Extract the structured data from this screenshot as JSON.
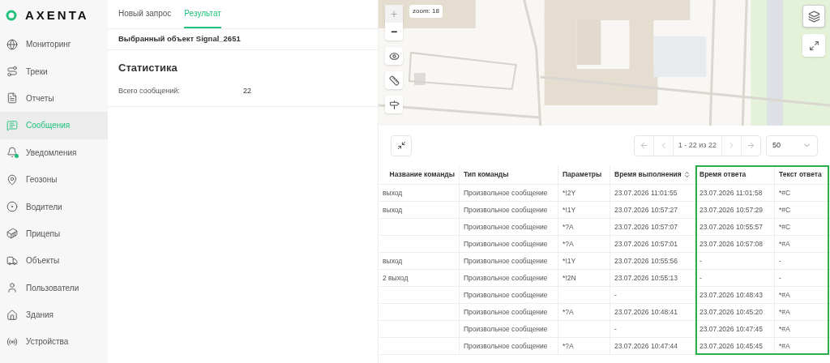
{
  "logo": {
    "text": "AXENTA"
  },
  "sidebar": {
    "items": [
      {
        "label": "Мониторинг",
        "selected": false,
        "dot": false
      },
      {
        "label": "Треки",
        "selected": false,
        "dot": false
      },
      {
        "label": "Отчеты",
        "selected": false,
        "dot": false
      },
      {
        "label": "Сообщения",
        "selected": true,
        "dot": false
      },
      {
        "label": "Уведомления",
        "selected": false,
        "dot": true
      },
      {
        "label": "Геозоны",
        "selected": false,
        "dot": false
      },
      {
        "label": "Водители",
        "selected": false,
        "dot": false
      },
      {
        "label": "Прицепы",
        "selected": false,
        "dot": false
      },
      {
        "label": "Объекты",
        "selected": false,
        "dot": false
      },
      {
        "label": "Пользователи",
        "selected": false,
        "dot": false
      },
      {
        "label": "Здания",
        "selected": false,
        "dot": false
      },
      {
        "label": "Устройства",
        "selected": false,
        "dot": false
      }
    ]
  },
  "tabs": [
    {
      "label": "Новый запрос",
      "selected": false
    },
    {
      "label": "Результат",
      "selected": true
    }
  ],
  "selected_object": "Выбранный объект Signal_2651",
  "statistics": {
    "title": "Статистика",
    "rows": [
      {
        "label": "Всего сообщений:",
        "value": "22"
      }
    ]
  },
  "map": {
    "zoom_label": "zoom: 18",
    "zoom_in": "+",
    "zoom_out": "−"
  },
  "pagination": {
    "range": "1 - 22 из 22",
    "page_size": "50"
  },
  "table": {
    "columns": [
      {
        "label": "Название команды",
        "sortable": false
      },
      {
        "label": "Тип команды",
        "sortable": false
      },
      {
        "label": "Параметры",
        "sortable": false
      },
      {
        "label": "Время выполнения",
        "sortable": true
      },
      {
        "label": "Время ответа",
        "sortable": false
      },
      {
        "label": "Текст ответа",
        "sortable": false
      }
    ],
    "annotation_frame": true,
    "rows": [
      [
        "выход",
        "Произвольное сообщение",
        "*!2Y",
        "23.07.2026 11:01:55",
        "23.07.2026 11:01:58",
        "*#C"
      ],
      [
        "выход",
        "Произвольное сообщение",
        "*!1Y",
        "23.07.2026 10:57:27",
        "23.07.2026 10:57:29",
        "*#C"
      ],
      [
        "",
        "Произвольное сообщение",
        "*?A",
        "23.07.2026 10:57:07",
        "23.07.2026 10:55:57",
        "*#C"
      ],
      [
        "",
        "Произвольное сообщение",
        "*?A",
        "23.07.2026 10:57:01",
        "23.07.2026 10:57:08",
        "*#A"
      ],
      [
        "выход",
        "Произвольное сообщение",
        "*!1Y",
        "23.07.2026 10:55:56",
        "-",
        "-"
      ],
      [
        "2 выход",
        "Произвольное сообщение",
        "*!2N",
        "23.07.2026 10:55:13",
        "-",
        "-"
      ],
      [
        "",
        "Произвольное сообщение",
        "",
        "-",
        "23.07.2026 10:48:43",
        "*#A"
      ],
      [
        "",
        "Произвольное сообщение",
        "*?A",
        "23.07.2026 10:48:41",
        "23.07.2026 10:45:20",
        "*#A"
      ],
      [
        "",
        "Произвольное сообщение",
        "",
        "-",
        "23.07.2026 10:47:45",
        "*#A"
      ],
      [
        "",
        "Произвольное сообщение",
        "*?A",
        "23.07.2026 10:47:44",
        "23.07.2026 10:45:45",
        "*#A"
      ]
    ]
  }
}
